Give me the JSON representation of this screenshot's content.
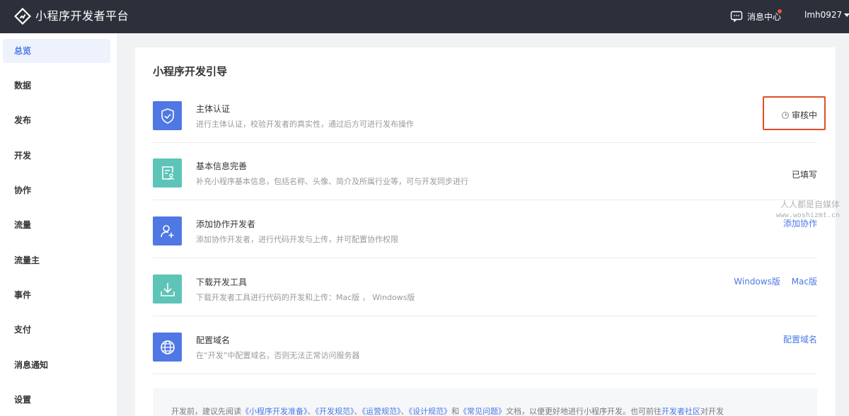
{
  "header": {
    "brand": "小程序开发者平台",
    "messages_label": "消息中心",
    "username": "lmh0927"
  },
  "sidebar": {
    "items": [
      {
        "label": "总览"
      },
      {
        "label": "数据"
      },
      {
        "label": "发布"
      },
      {
        "label": "开发"
      },
      {
        "label": "协作"
      },
      {
        "label": "流量"
      },
      {
        "label": "流量主"
      },
      {
        "label": "事件"
      },
      {
        "label": "支付"
      },
      {
        "label": "消息通知"
      },
      {
        "label": "设置"
      }
    ]
  },
  "main": {
    "title": "小程序开发引导",
    "steps": [
      {
        "title": "主体认证",
        "desc": "进行主体认证，校验开发者的真实性，通过后方可进行发布操作",
        "status": "审核中",
        "icon": "shield-check-icon"
      },
      {
        "title": "基本信息完善",
        "desc": "补充小程序基本信息，包括名称、头像、简介及所属行业等，可与开发同步进行",
        "status": "已填写",
        "icon": "profile-form-icon"
      },
      {
        "title": "添加协作开发者",
        "desc": "添加协作开发者，进行代码开发与上传，并可配置协作权限",
        "action": "添加协作",
        "icon": "add-user-icon"
      },
      {
        "title": "下载开发工具",
        "desc": "下载开发者工具进行代码的开发和上传：Mac版 ， Windows版",
        "action_windows": "Windows版",
        "action_mac": "Mac版",
        "icon": "download-icon"
      },
      {
        "title": "配置域名",
        "desc": "在“开发”中配置域名，否则无法正常访问服务器",
        "action": "配置域名",
        "icon": "globe-icon"
      }
    ],
    "footer": {
      "prefix": "开发前，建议先阅读",
      "link1": "《小程序开发准备》",
      "sep1": "、",
      "link2": "《开发规范》",
      "sep2": "、",
      "link3": "《运营规范》",
      "sep3": "、",
      "link4": "《设计规范》",
      "and": "和",
      "link5": "《常见问题》",
      "mid": "文档，以便更好地进行小程序开发。也可前往",
      "link6": "开发者社区",
      "suffix": "对开发"
    }
  },
  "watermark": {
    "name": "人人都是自媒体",
    "url": "www.woshizmt.cn"
  },
  "colors": {
    "topbar": "#2b303b",
    "accent": "#4a79e6",
    "icon_blue": "#4f78e5",
    "icon_teal": "#5ec4b8",
    "highlight_border": "#e04f27"
  }
}
